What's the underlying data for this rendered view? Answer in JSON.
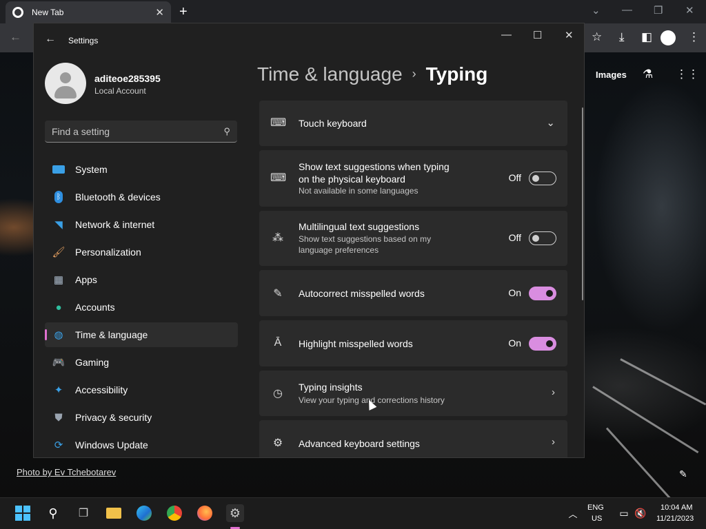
{
  "browser": {
    "tab_title": "New Tab",
    "new_tab_label": "+",
    "ntp_links": [
      "Images"
    ],
    "photo_credit": "Photo by Ev Tchebotarev"
  },
  "settings": {
    "app_title": "Settings",
    "user": {
      "name": "aditeoe285395",
      "account_type": "Local Account"
    },
    "search_placeholder": "Find a setting",
    "nav": [
      {
        "label": "System",
        "icon": "system-icon"
      },
      {
        "label": "Bluetooth & devices",
        "icon": "bluetooth-icon"
      },
      {
        "label": "Network & internet",
        "icon": "wifi-icon"
      },
      {
        "label": "Personalization",
        "icon": "brush-icon"
      },
      {
        "label": "Apps",
        "icon": "apps-icon"
      },
      {
        "label": "Accounts",
        "icon": "accounts-icon"
      },
      {
        "label": "Time & language",
        "icon": "globe-clock-icon",
        "active": true
      },
      {
        "label": "Gaming",
        "icon": "gamepad-icon"
      },
      {
        "label": "Accessibility",
        "icon": "accessibility-icon"
      },
      {
        "label": "Privacy & security",
        "icon": "shield-icon"
      },
      {
        "label": "Windows Update",
        "icon": "update-icon"
      }
    ],
    "breadcrumb": {
      "parent": "Time & language",
      "separator": "›",
      "current": "Typing"
    },
    "cards": [
      {
        "title": "Touch keyboard",
        "icon": "keyboard-icon",
        "control": "expand"
      },
      {
        "title": "Show text suggestions when typing on the physical keyboard",
        "subtitle": "Not available in some languages",
        "icon": "keyboard-icon",
        "state": "Off"
      },
      {
        "title": "Multilingual text suggestions",
        "subtitle": "Show text suggestions based on my language preferences",
        "icon": "language-icon",
        "state": "Off"
      },
      {
        "title": "Autocorrect misspelled words",
        "icon": "autocorrect-icon",
        "state": "On"
      },
      {
        "title": "Highlight misspelled words",
        "icon": "highlight-icon",
        "state": "On"
      },
      {
        "title": "Typing insights",
        "subtitle": "View your typing and corrections history",
        "icon": "history-icon",
        "control": "chevron"
      },
      {
        "title": "Advanced keyboard settings",
        "icon": "gear-icon",
        "control": "chevron"
      }
    ],
    "accent_color": "#d98de0"
  },
  "taskbar": {
    "language": "ENG",
    "region": "US",
    "time": "10:04 AM",
    "date": "11/21/2023"
  }
}
